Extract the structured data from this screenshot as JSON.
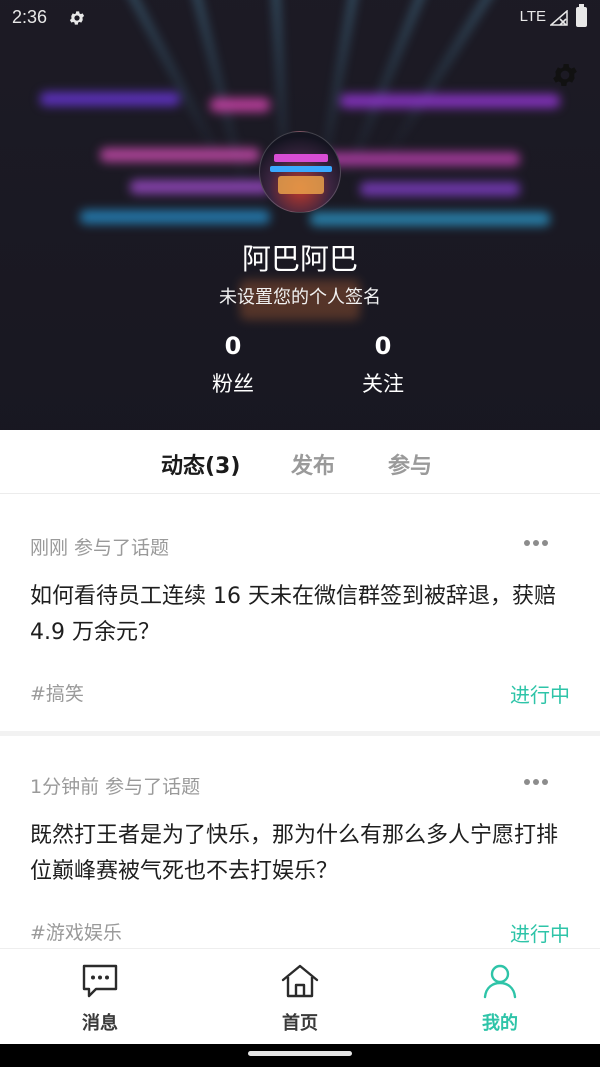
{
  "status_bar": {
    "time": "2:36",
    "network": "LTE",
    "settings_icon": "gear-icon"
  },
  "profile": {
    "name": "阿巴阿巴",
    "signature": "未设置您的个人签名",
    "fans_count": "0",
    "fans_label": "粉丝",
    "following_count": "0",
    "following_label": "关注",
    "settings_icon": "gear-icon"
  },
  "tabs": [
    {
      "label": "动态(3)",
      "active": true
    },
    {
      "label": "发布",
      "active": false
    },
    {
      "label": "参与",
      "active": false
    }
  ],
  "feed": [
    {
      "meta": "刚刚 参与了话题",
      "title": "如何看待员工连续 16 天未在微信群签到被辞退，获赔 4.9 万余元？",
      "tag": "#搞笑",
      "status": "进行中"
    },
    {
      "meta": "1分钟前 参与了话题",
      "title": "既然打王者是为了快乐，那为什么有那么多人宁愿打排位巅峰赛被气死也不去打娱乐？",
      "tag": "#游戏娱乐",
      "status": "进行中"
    }
  ],
  "bottom_nav": [
    {
      "label": "消息",
      "icon": "message-icon",
      "active": false
    },
    {
      "label": "首页",
      "icon": "home-icon",
      "active": false
    },
    {
      "label": "我的",
      "icon": "user-icon",
      "active": true
    }
  ],
  "colors": {
    "accent": "#2ec4a8",
    "text_primary": "#1e1e1e",
    "text_secondary": "#9a9a9a"
  }
}
